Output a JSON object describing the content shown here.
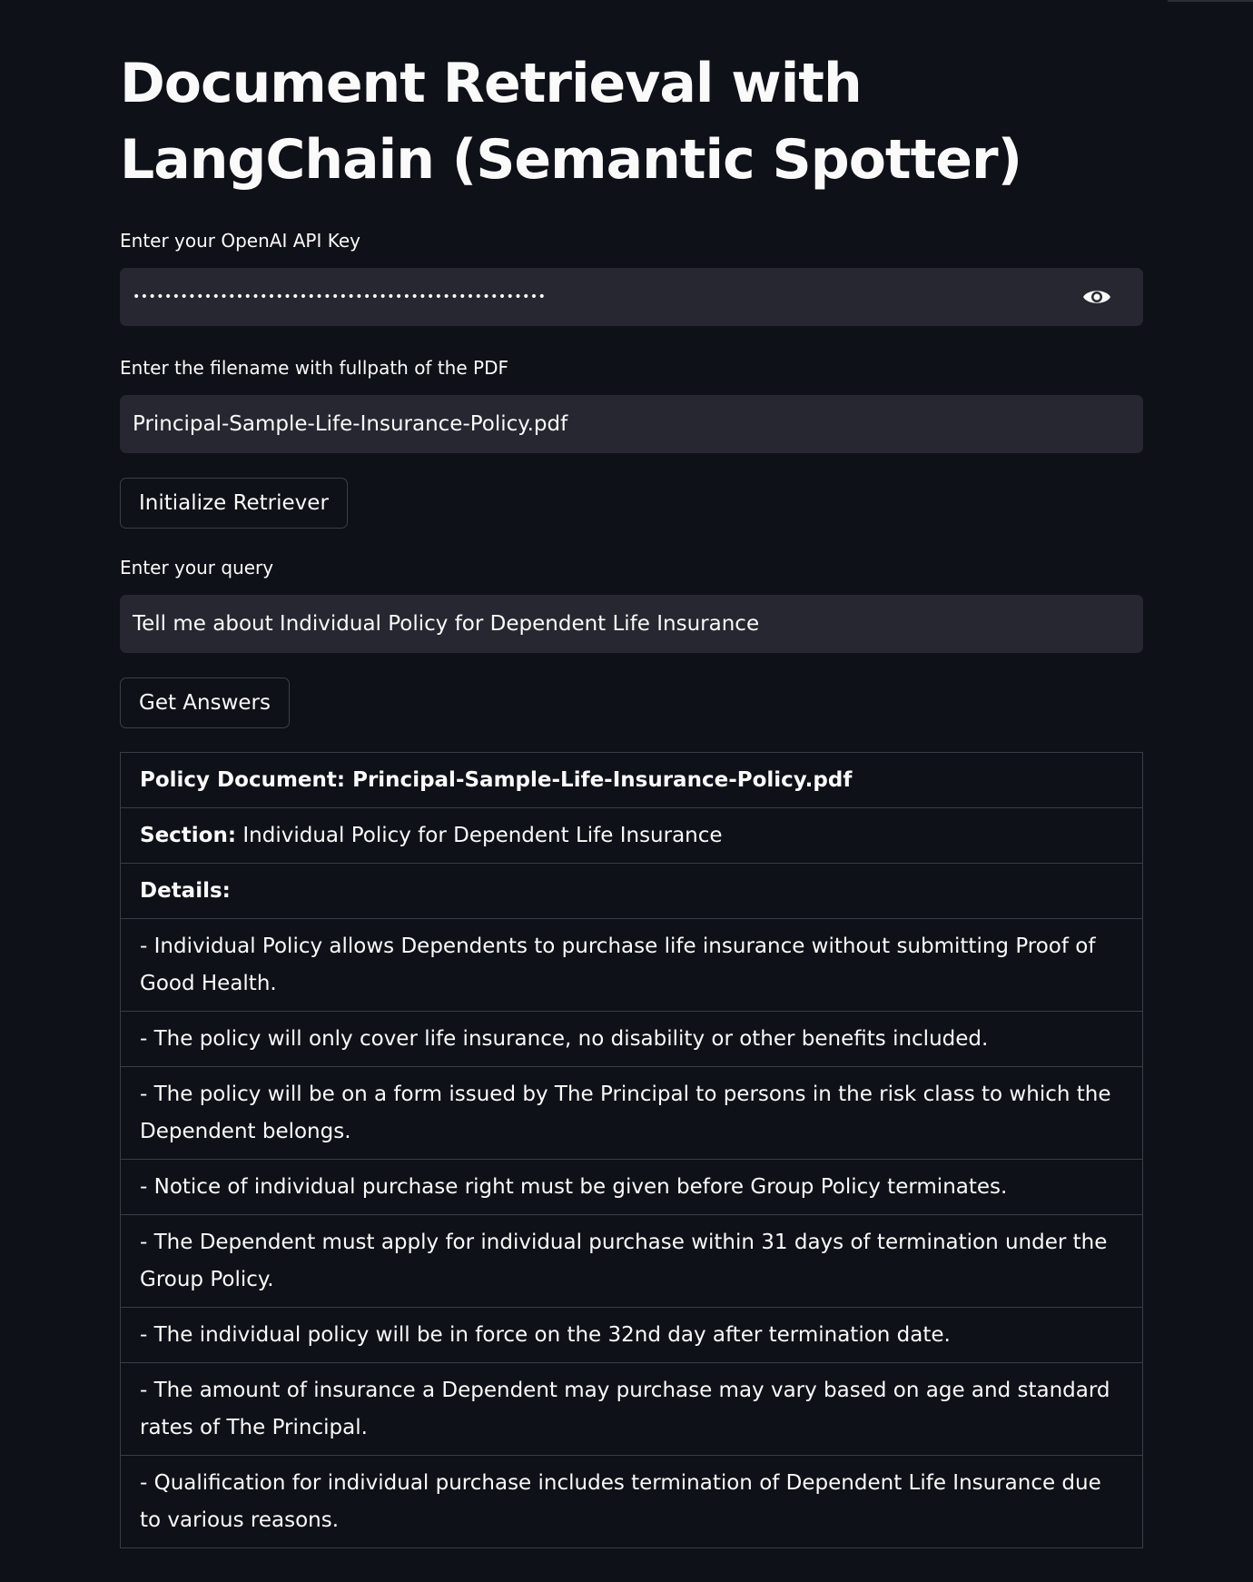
{
  "page": {
    "title": "Document Retrieval with LangChain (Semantic Spotter)"
  },
  "api_key": {
    "label": "Enter your OpenAI API Key",
    "masked_value": "••••••••••••••••••••••••••••••••••••••••••••••••••••",
    "toggle_icon": "eye-icon"
  },
  "pdf": {
    "label": "Enter the filename with fullpath of the PDF",
    "value": "Principal-Sample-Life-Insurance-Policy.pdf"
  },
  "init_button": {
    "label": "Initialize Retriever"
  },
  "query": {
    "label": "Enter your query",
    "value": "Tell me about Individual Policy for Dependent Life Insurance"
  },
  "answer_button": {
    "label": "Get Answers"
  },
  "results": {
    "policy_document": "Policy Document: Principal-Sample-Life-Insurance-Policy.pdf",
    "section_label": "Section:",
    "section_value": "Individual Policy for Dependent Life Insurance",
    "details_label": "Details:",
    "details": [
      "- Individual Policy allows Dependents to purchase life insurance without submitting Proof of Good Health.",
      "- The policy will only cover life insurance, no disability or other benefits included.",
      "- The policy will be on a form issued by The Principal to persons in the risk class to which the Dependent belongs.",
      "- Notice of individual purchase right must be given before Group Policy terminates.",
      "- The Dependent must apply for individual purchase within 31 days of termination under the Group Policy.",
      "- The individual policy will be in force on the 32nd day after termination date.",
      "- The amount of insurance a Dependent may purchase may vary based on age and standard rates of The Principal.",
      "- Qualification for individual purchase includes termination of Dependent Life Insurance due to various reasons."
    ]
  },
  "colors": {
    "background": "#0e1117",
    "input_background": "#262730",
    "text": "#fafafa",
    "border": "#3a3d45"
  }
}
